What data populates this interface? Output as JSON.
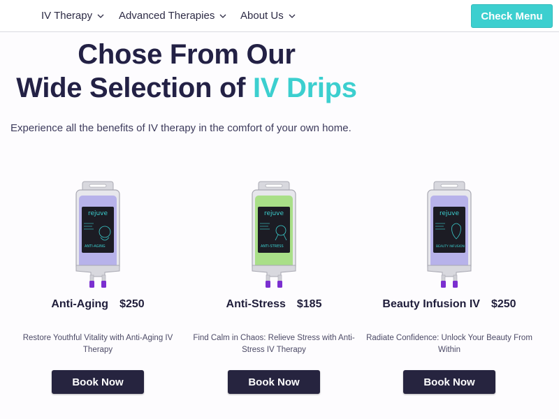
{
  "nav": {
    "items": [
      {
        "label": "IV Therapy"
      },
      {
        "label": "Advanced Therapies"
      },
      {
        "label": "About Us"
      }
    ],
    "cta_label": "Check Menu"
  },
  "hero": {
    "line1": "Chose From Our",
    "line2_prefix": "Wide Selection of ",
    "line2_accent": "IV Drips",
    "subtitle": "Experience all the benefits of IV therapy in the comfort of your own home."
  },
  "products": [
    {
      "name": "Anti-Aging",
      "price": "$250",
      "description": "Restore Youthful Vitality with Anti-Aging IV Therapy",
      "button": "Book Now",
      "bag_brand": "rejuve",
      "bag_label": "ANTI-AGING",
      "bag_color": "#b7b2ea"
    },
    {
      "name": "Anti-Stress",
      "price": "$185",
      "description": "Find Calm in Chaos: Relieve Stress with Anti-Stress IV Therapy",
      "button": "Book Now",
      "bag_brand": "rejuve",
      "bag_label": "ANTI-STRESS",
      "bag_color": "#a9df88"
    },
    {
      "name": "Beauty Infusion IV",
      "price": "$250",
      "description": "Radiate Confidence: Unlock Your Beauty From Within",
      "button": "Book Now",
      "bag_brand": "rejuve",
      "bag_label": "BEAUTY INFUSION",
      "bag_color": "#b7b2ea"
    }
  ],
  "colors": {
    "accent": "#3ccfcf",
    "dark": "#26243f",
    "heading": "#232145"
  }
}
